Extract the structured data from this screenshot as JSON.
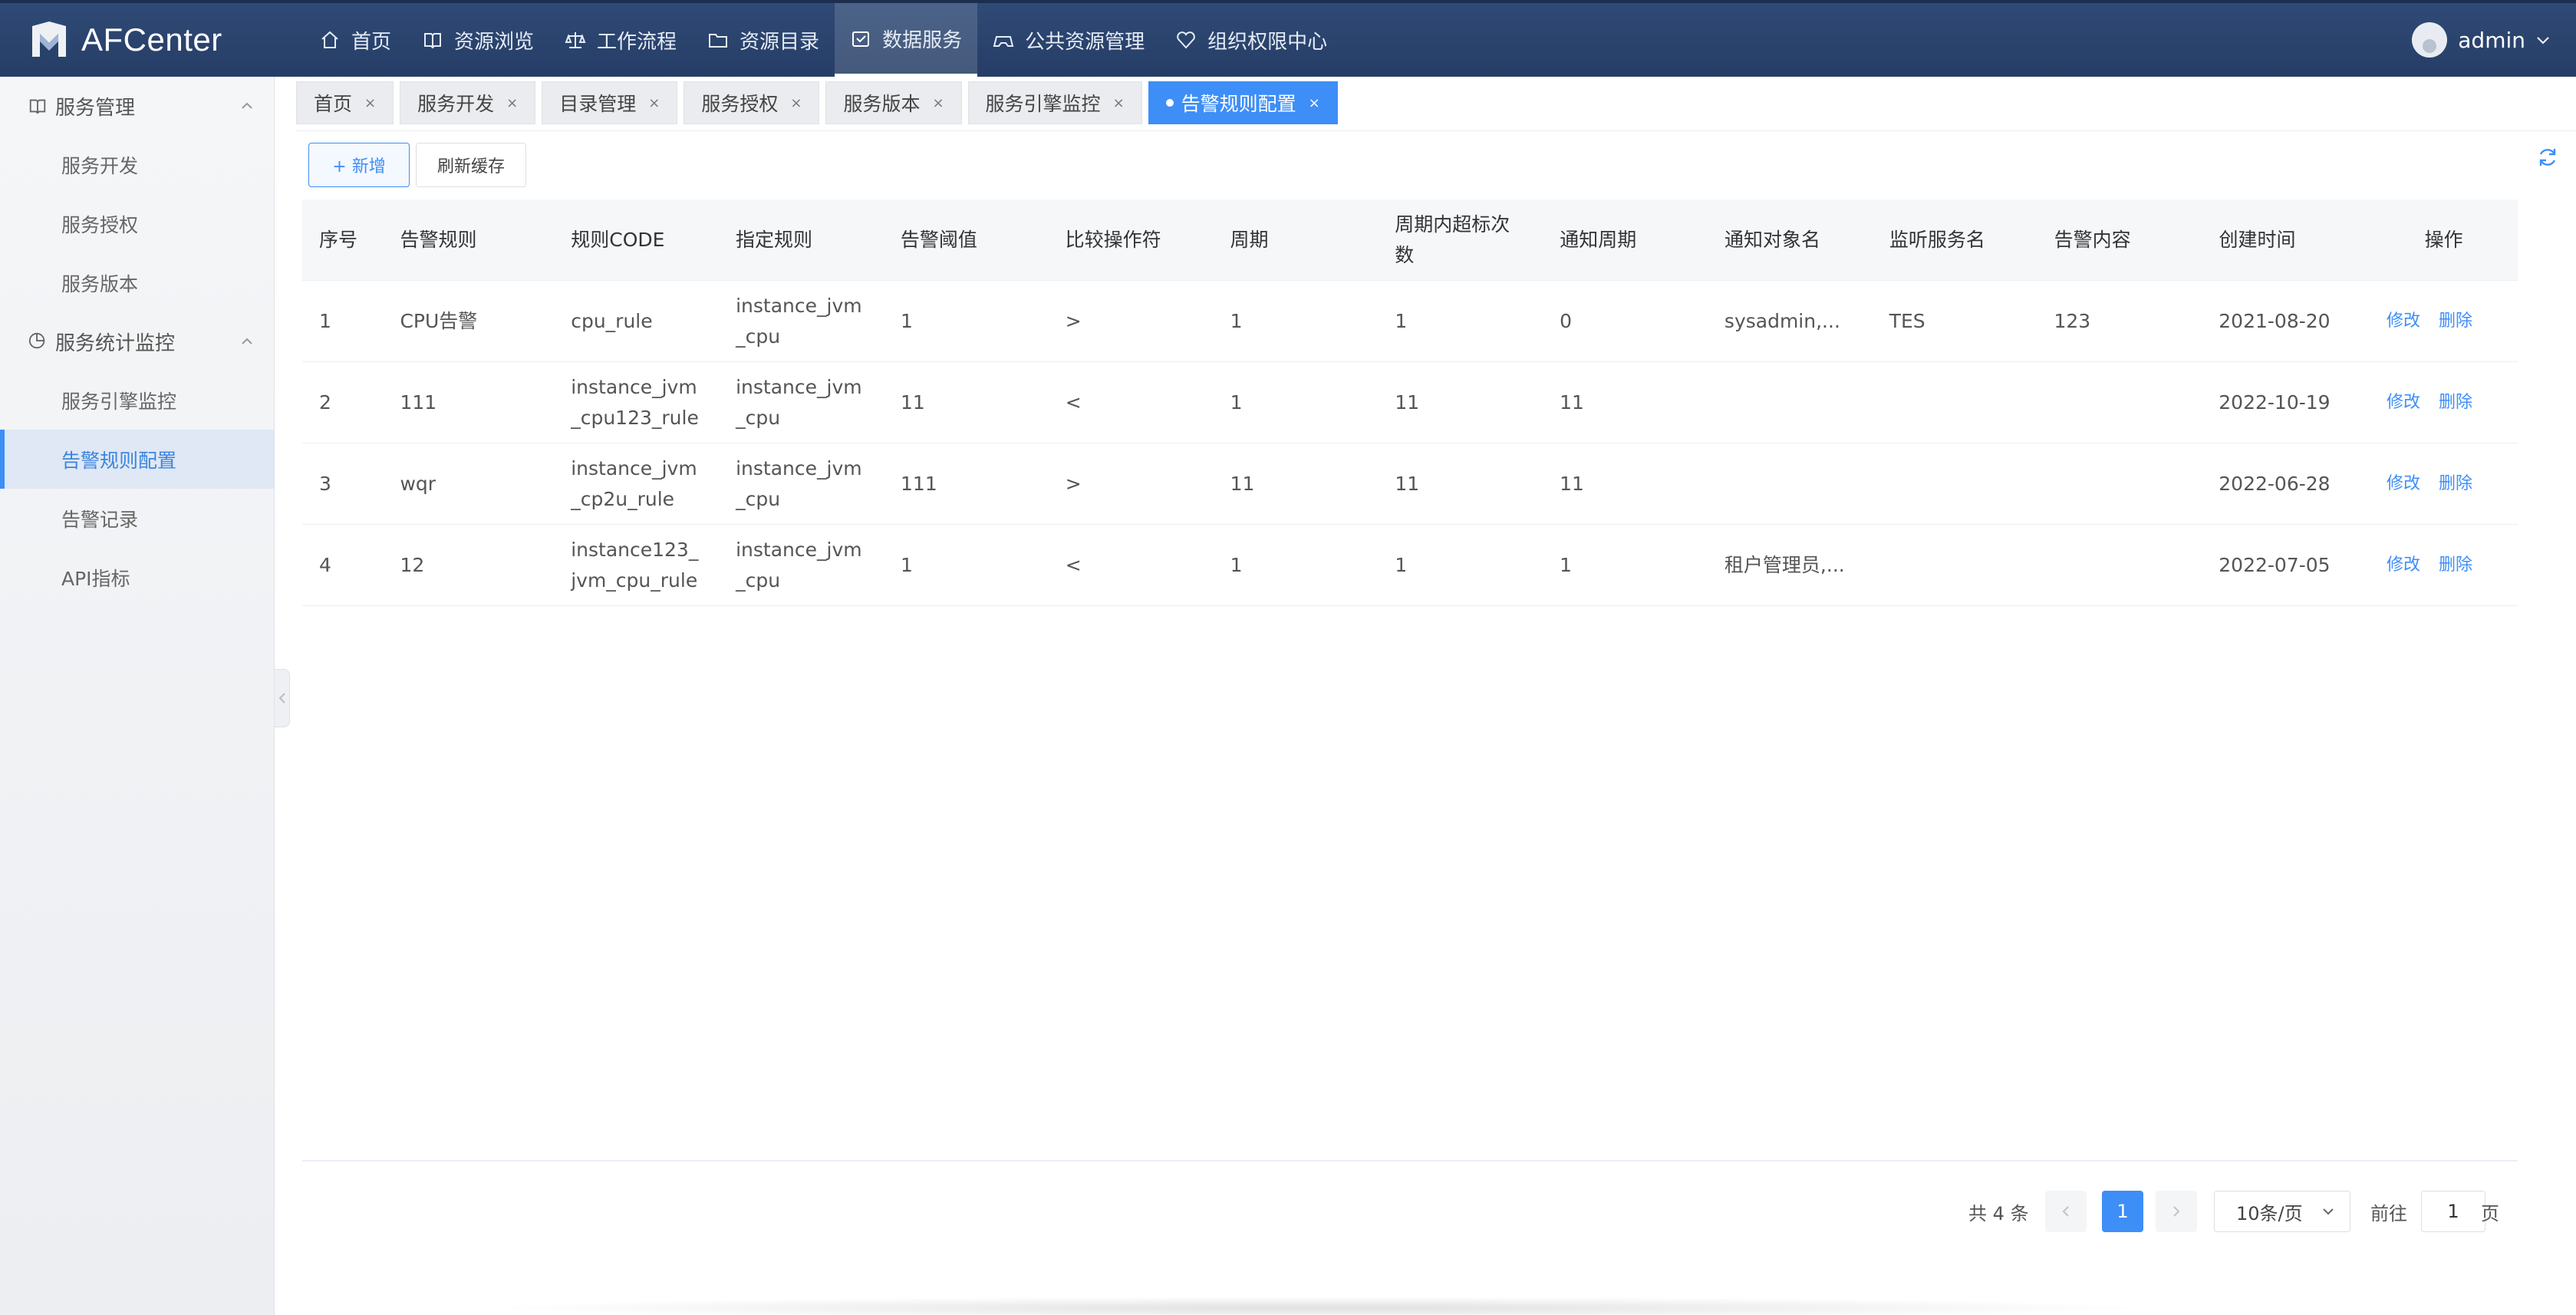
{
  "app": {
    "name": "AFCenter",
    "user": "admin"
  },
  "nav": [
    {
      "label": "首页",
      "icon": "home-icon"
    },
    {
      "label": "资源浏览",
      "icon": "book-icon"
    },
    {
      "label": "工作流程",
      "icon": "scale-icon"
    },
    {
      "label": "资源目录",
      "icon": "folder-icon"
    },
    {
      "label": "数据服务",
      "icon": "service-icon",
      "active": true
    },
    {
      "label": "公共资源管理",
      "icon": "gamepad-icon"
    },
    {
      "label": "组织权限中心",
      "icon": "heart-icon"
    }
  ],
  "sidebar": {
    "groups": [
      {
        "label": "服务管理",
        "icon": "book-icon",
        "items": [
          "服务开发",
          "服务授权",
          "服务版本"
        ]
      },
      {
        "label": "服务统计监控",
        "icon": "pie-chart-icon",
        "items": [
          "服务引擎监控",
          "告警规则配置",
          "告警记录",
          "API指标"
        ]
      }
    ],
    "active_item": "告警规则配置"
  },
  "tabs": [
    {
      "label": "首页"
    },
    {
      "label": "服务开发"
    },
    {
      "label": "目录管理"
    },
    {
      "label": "服务授权"
    },
    {
      "label": "服务版本"
    },
    {
      "label": "服务引擎监控"
    },
    {
      "label": "告警规则配置",
      "active": true
    }
  ],
  "toolbar": {
    "add_label": "+ 新增",
    "refresh_label": "刷新缓存"
  },
  "table": {
    "headers": [
      "序号",
      "告警规则",
      "规则CODE",
      "指定规则",
      "告警阈值",
      "比较操作符",
      "周期",
      "周期内超标次数",
      "通知周期",
      "通知对象名",
      "监听服务名",
      "告警内容",
      "创建时间",
      "操作"
    ],
    "rows": [
      [
        "1",
        "CPU告警",
        "cpu_rule",
        "instance_jvm_cpu",
        "1",
        ">",
        "1",
        "1",
        "0",
        "sysadmin,...",
        "TES",
        "123",
        "2021-08-20"
      ],
      [
        "2",
        "111",
        "instance_jvm_cpu123_rule",
        "instance_jvm_cpu",
        "11",
        "<",
        "1",
        "11",
        "11",
        "",
        "",
        "",
        "2022-10-19"
      ],
      [
        "3",
        "wqr",
        "instance_jvm_cp2u_rule",
        "instance_jvm_cpu",
        "111",
        ">",
        "11",
        "11",
        "11",
        "",
        "",
        "",
        "2022-06-28"
      ],
      [
        "4",
        "12",
        "instance123_jvm_cpu_rule",
        "instance_jvm_cpu",
        "1",
        "<",
        "1",
        "1",
        "1",
        "租户管理员,...",
        "",
        "",
        "2022-07-05"
      ]
    ],
    "row_actions": {
      "edit": "修改",
      "delete": "删除"
    }
  },
  "pagination": {
    "total_text": "共 4 条",
    "current_page": "1",
    "page_size": "10条/页",
    "goto_prefix": "前往",
    "goto_value": "1",
    "goto_suffix": "页"
  },
  "colors": {
    "primary": "#3e8ef7",
    "header_bg": "#2f4a76"
  }
}
